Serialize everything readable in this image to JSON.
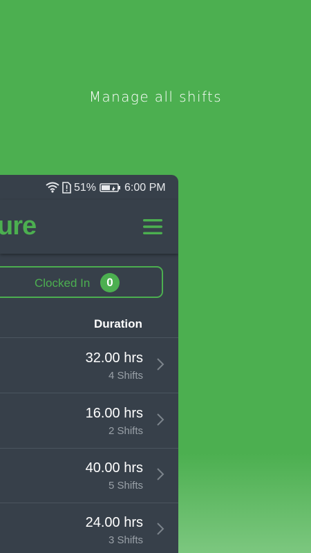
{
  "headline": "Manage all shifts",
  "status_bar": {
    "battery_percent": "51%",
    "time": "6:00 PM"
  },
  "app": {
    "logo_text": "ure",
    "accent_color": "#4caf50",
    "background_color": "#37404a"
  },
  "clocked_in": {
    "label": "Clocked In",
    "count": "0"
  },
  "table": {
    "column_header": "Duration",
    "rows": [
      {
        "hours": "32.00 hrs",
        "shifts": "4 Shifts"
      },
      {
        "hours": "16.00 hrs",
        "shifts": "2 Shifts"
      },
      {
        "hours": "40.00 hrs",
        "shifts": "5 Shifts"
      },
      {
        "hours": "24.00 hrs",
        "shifts": "3 Shifts"
      }
    ]
  }
}
